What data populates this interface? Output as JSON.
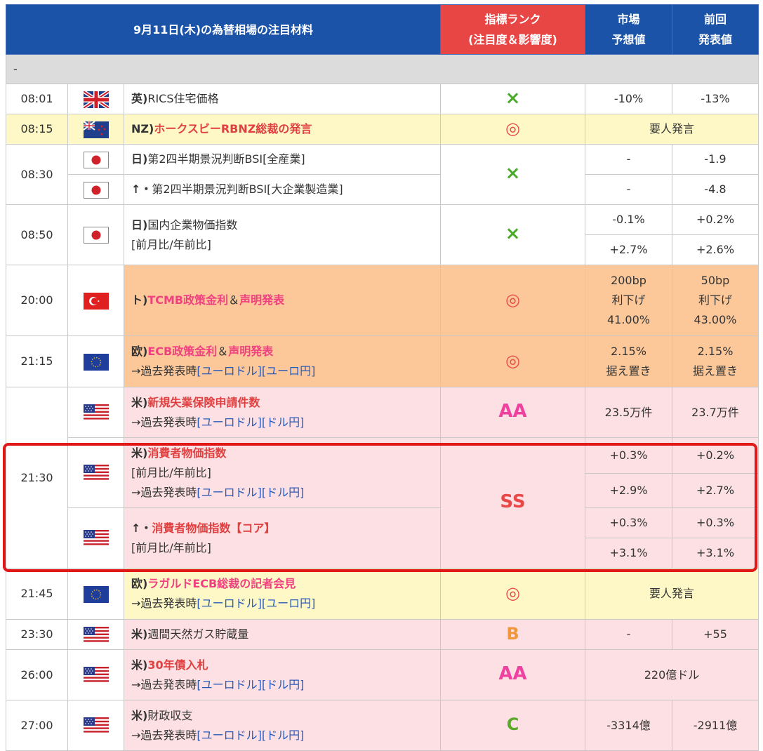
{
  "header": {
    "title": "9月11日(木)の為替相場の注目材料",
    "rank_line1": "指標ランク",
    "rank_line2": "(注目度＆影響度)",
    "forecast_line1": "市場",
    "forecast_line2": "予想値",
    "prev_line1": "前回",
    "prev_line2": "発表値"
  },
  "separator": "-",
  "past_prefix": "→過去発表時",
  "links": {
    "eurusd": "[ユーロドル]",
    "eurjpy": "[ユーロ円]",
    "usdjpy": "[ドル円]"
  },
  "mom_yoy": "[前月比/年前比]",
  "rows": {
    "r0801": {
      "time": "08:01",
      "country": "英)",
      "name": "RICS住宅価格",
      "rank": "×",
      "forecast": "-10%",
      "previous": "-13%"
    },
    "r0815": {
      "time": "08:15",
      "country": "NZ)",
      "name": "ホークスビーRBNZ総裁の発言",
      "rank": "◎",
      "merged": "要人発言"
    },
    "r0830": {
      "time": "08:30",
      "country": "日)",
      "name": "第2四半期景況判断BSI[全産業]",
      "forecast": "-",
      "previous": "-1.9",
      "sub_prefix": "↑・",
      "sub_name": "第2四半期景況判断BSI[大企業製造業]",
      "sub_forecast": "-",
      "sub_previous": "-4.8",
      "rank": "×"
    },
    "r0850": {
      "time": "08:50",
      "country": "日)",
      "name": "国内企業物価指数",
      "rank": "×",
      "f1": "-0.1%",
      "p1": "+0.2%",
      "f2": "+2.7%",
      "p2": "+2.6%"
    },
    "r2000": {
      "time": "20:00",
      "country": "ト)",
      "name1": "TCMB政策金利",
      "amp": "＆",
      "name2": "声明発表",
      "rank": "◎",
      "forecast": [
        "200bp",
        "利下げ",
        "41.00%"
      ],
      "previous": [
        "50bp",
        "利下げ",
        "43.00%"
      ]
    },
    "r2115": {
      "time": "21:15",
      "country": "欧)",
      "name1": "ECB政策金利",
      "amp": "＆",
      "name2": "声明発表",
      "rank": "◎",
      "forecast": [
        "2.15%",
        "据え置き"
      ],
      "previous": [
        "2.15%",
        "据え置き"
      ]
    },
    "r2130a": {
      "country": "米)",
      "name": "新規失業保険申請件数",
      "rank": "AA",
      "forecast": "23.5万件",
      "previous": "23.7万件"
    },
    "r2130b": {
      "time": "21:30",
      "country": "米)",
      "name": "消費者物価指数",
      "rank": "SS",
      "f1": "+0.3%",
      "p1": "+0.2%",
      "f2": "+2.9%",
      "p2": "+2.7%"
    },
    "r2130c": {
      "prefix": "↑・",
      "name": "消費者物価指数【コア】",
      "f1": "+0.3%",
      "p1": "+0.3%",
      "f2": "+3.1%",
      "p2": "+3.1%"
    },
    "r2145": {
      "time": "21:45",
      "country": "欧)",
      "name": "ラガルドECB総裁の記者会見",
      "rank": "◎",
      "merged": "要人発言"
    },
    "r2330": {
      "time": "23:30",
      "country": "米)",
      "name": "週間天然ガス貯蔵量",
      "rank": "B",
      "forecast": "-",
      "previous": "+55"
    },
    "r2600": {
      "time": "26:00",
      "country": "米)",
      "name": "30年債入札",
      "rank": "AA",
      "merged": "220億ドル"
    },
    "r2700": {
      "time": "27:00",
      "country": "米)",
      "name": "財政収支",
      "rank": "C",
      "forecast": "-3314億",
      "previous": "-2911億"
    }
  },
  "colors": {
    "header_blue": "#1a53a8",
    "header_red": "#e84545",
    "yellow_row": "#fdf8c6",
    "orange_row": "#fcc89a",
    "pink_row": "#fde0e3",
    "highlight_box": "#e01818"
  }
}
